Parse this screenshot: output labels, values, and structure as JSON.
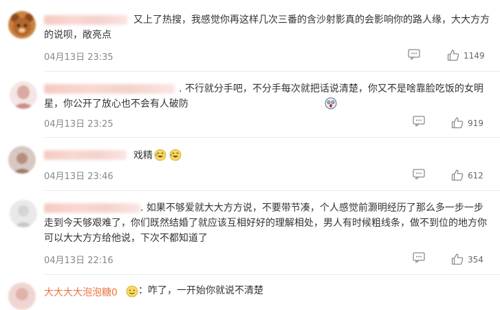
{
  "comments": [
    {
      "text": "又上了热搜，我感觉你再这样几次三番的含沙射影真的会影响你的路人缘，大大方方的说呗，敞亮点",
      "time": "04月13日 23:35",
      "likes": "1149",
      "avatar_icon": "bear-avatar-icon"
    },
    {
      "text": ". 不行就分手吧，不分手每次就把话说清楚，你又不是啥靠脸吃饭的女明星，你公开了放心也不会有人破防",
      "time": "04月13日 23:25",
      "likes": "919",
      "emoji": "scared-face-emoji"
    },
    {
      "text": "戏精",
      "time": "04月13日 23:46",
      "likes": "612",
      "emoji": "laughing-emoji"
    },
    {
      "text": ". 如果不够爱就大大方方说，不要带节凑，个人感觉前灏明经历了那么多一步一步走到今天够艰难了，你们既然结婚了就应该互相好好的理解相处，男人有时候粗线条，做不到位的地方你可以大大方方给他说，下次不都知道了",
      "time": "04月13日 22:16",
      "likes": "354"
    },
    {
      "name": "大大大大泡泡糖0",
      "text": "：咋了，一开始你就说不清楚"
    }
  ],
  "colors": {
    "username": "#eb7340",
    "icon": "#8a8a8a"
  }
}
